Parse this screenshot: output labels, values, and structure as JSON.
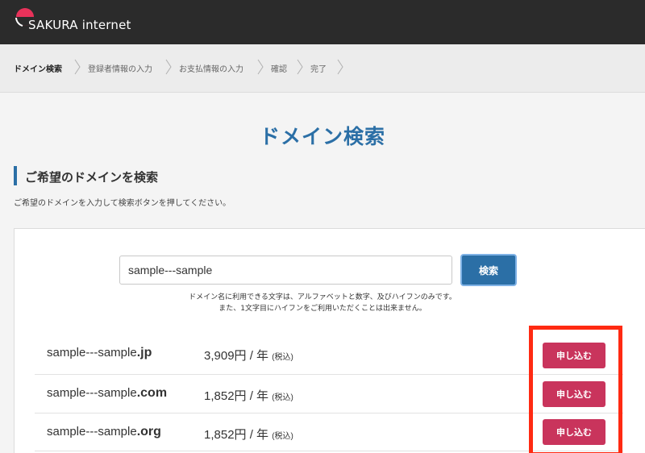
{
  "header": {
    "logo_text": "SAKURA internet"
  },
  "breadcrumb": [
    {
      "label": "ドメイン検索",
      "active": true
    },
    {
      "label": "登録者情報の入力",
      "active": false
    },
    {
      "label": "お支払情報の入力",
      "active": false
    },
    {
      "label": "確認",
      "active": false
    },
    {
      "label": "完了",
      "active": false
    }
  ],
  "page": {
    "title": "ドメイン検索",
    "section_title": "ご希望のドメインを検索",
    "description": "ご希望のドメインを入力して検索ボタンを押してください。"
  },
  "search": {
    "value": "sample---sample",
    "button_label": "検索",
    "notes": [
      "ドメイン名に利用できる文字は、アルファベットと数字、及びハイフンのみです。",
      "また、1文字目にハイフンをご利用いただくことは出来ません。"
    ]
  },
  "results": [
    {
      "name": "sample---sample",
      "tld": ".jp",
      "price": "3,909円 / 年",
      "tax": "(税込)",
      "button": "申し込む"
    },
    {
      "name": "sample---sample",
      "tld": ".com",
      "price": "1,852円 / 年",
      "tax": "(税込)",
      "button": "申し込む"
    },
    {
      "name": "sample---sample",
      "tld": ".org",
      "price": "1,852円 / 年",
      "tax": "(税込)",
      "button": "申し込む"
    }
  ],
  "colors": {
    "header_bg": "#2b2b2b",
    "accent_blue": "#2b6fa6",
    "apply_red": "#c9345c",
    "highlight_red": "#ff2a12"
  }
}
